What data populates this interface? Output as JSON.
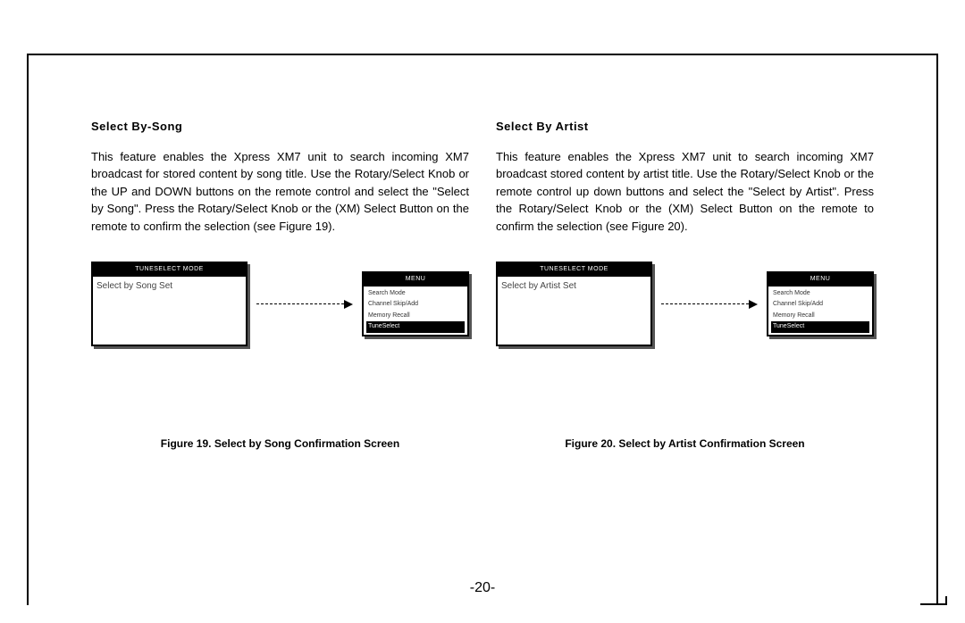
{
  "page_number": "-20-",
  "left": {
    "heading": "Select  By-Song",
    "body": "This feature enables the Xpress XM7 unit to search incoming XM7 broadcast for stored content by song title.  Use the Rotary/Select Knob or the UP and DOWN buttons on the remote control and select the \"Select by Song\".  Press the Rotary/Select Knob or the (XM) Select Button on the remote to confirm the selection (see Figure 19).",
    "screen": {
      "title": "TUNESELECT MODE",
      "line": "Select by Song Set"
    },
    "menu": {
      "title": "MENU",
      "items": [
        "Search Mode",
        "Channel Skip/Add",
        "Memory Recall"
      ],
      "selected": "TuneSelect"
    },
    "caption": "Figure 19. Select by Song Confirmation Screen"
  },
  "right": {
    "heading": "Select  By  Artist",
    "body": "This feature enables the Xpress XM7 unit to search  incoming XM7 broadcast stored content by artist title.  Use the Rotary/Select Knob or the remote control up down buttons and select the \"Select by Artist\".  Press the Rotary/Select Knob or the (XM) Select Button on the remote to confirm the selection (see Figure 20).",
    "screen": {
      "title": "TUNESELECT MODE",
      "line": "Select by Artist Set"
    },
    "menu": {
      "title": "MENU",
      "items": [
        "Search Mode",
        "Channel Skip/Add",
        "Memory Recall"
      ],
      "selected": "TuneSelect"
    },
    "caption": "Figure 20. Select by Artist Confirmation Screen"
  }
}
